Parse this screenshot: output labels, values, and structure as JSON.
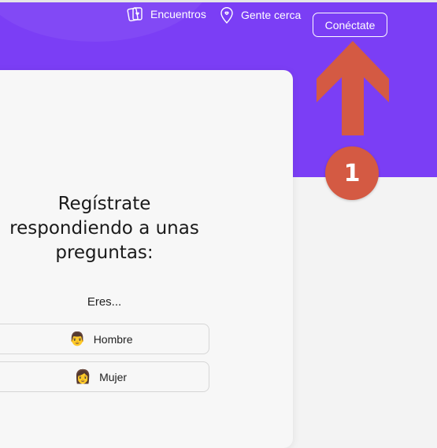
{
  "nav": {
    "encuentros_label": "Encuentros",
    "gente_cerca_label": "Gente cerca",
    "connect_label": "Conéctate"
  },
  "signup": {
    "title_line1": "Regístrate",
    "title_line2": "respondiendo a unas",
    "title_line3": "preguntas:",
    "question": "Eres...",
    "options": [
      {
        "label": "Hombre",
        "emoji": "👨"
      },
      {
        "label": "Mujer",
        "emoji": "👩"
      }
    ]
  },
  "annotation": {
    "step_number": "1"
  },
  "colors": {
    "brand_purple": "#7b3ef5",
    "annotation_orange": "#d45a43"
  },
  "icons": [
    "cards-heart-icon",
    "location-pin-icon",
    "arrow-up-icon"
  ]
}
